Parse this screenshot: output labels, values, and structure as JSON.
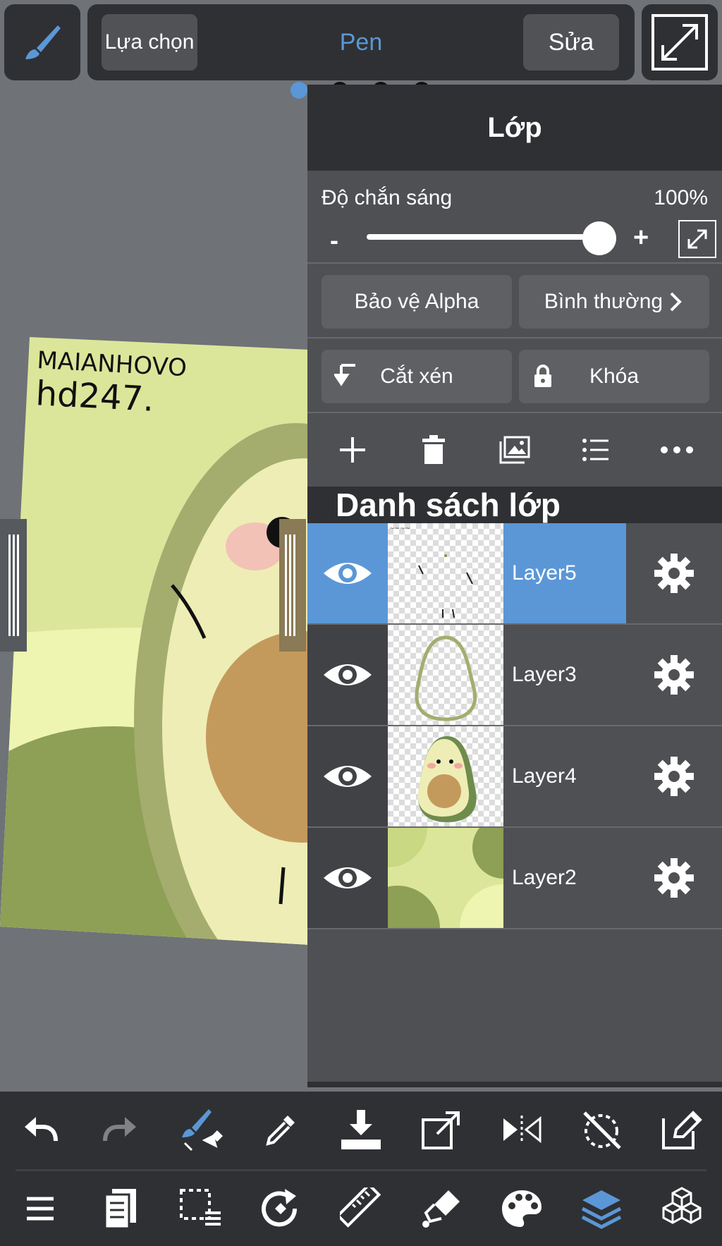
{
  "topbar": {
    "select_label": "Lựa chọn",
    "tool_name": "Pen",
    "edit_label": "Sửa",
    "tool_color": "#5b97d6"
  },
  "canvas": {
    "signature_line1": "MAIANHOVO",
    "signature_line2": "hd247."
  },
  "layer_panel": {
    "title": "Lớp",
    "opacity": {
      "label": "Độ chắn sáng",
      "value": "100%",
      "minus": "-",
      "plus": "+",
      "level": 1.0
    },
    "alpha_protect_label": "Bảo vệ Alpha",
    "blend_mode_label": "Bình thường",
    "clipping_label": "Cắt xén",
    "lock_label": "Khóa",
    "tools": [
      "add-icon",
      "trash-icon",
      "image-import-icon",
      "list-icon",
      "more-icon"
    ],
    "list_title": "Danh sách lớp",
    "layers": [
      {
        "name": "Layer5",
        "selected": true,
        "visible": true
      },
      {
        "name": "Layer3",
        "selected": false,
        "visible": true
      },
      {
        "name": "Layer4",
        "selected": false,
        "visible": true
      },
      {
        "name": "Layer2",
        "selected": false,
        "visible": true
      }
    ]
  },
  "toolbar_row1": [
    "undo-icon",
    "redo-icon",
    "brush-rotate-icon",
    "eyedropper-icon",
    "download-icon",
    "transform-icon",
    "flip-icon",
    "rotate-off-icon",
    "edit-icon"
  ],
  "toolbar_row2": [
    "menu-icon",
    "pages-icon",
    "selection-icon",
    "snap-icon",
    "ruler-icon",
    "fill-icon",
    "palette-icon",
    "layers-icon",
    "materials-icon"
  ],
  "colors": {
    "accent": "#5b97d6",
    "panel": "#4e5054",
    "dark": "#2f3033",
    "avocado_bg": "#dbe69a",
    "avocado_dark": "#8e9f56"
  }
}
